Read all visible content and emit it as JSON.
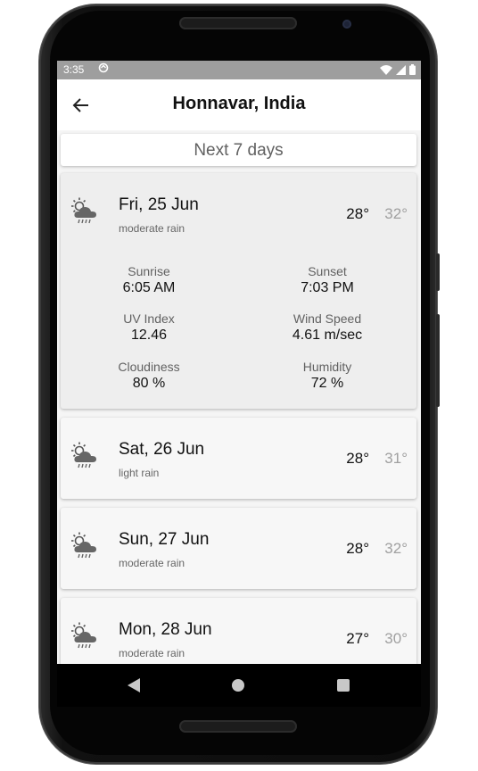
{
  "status_bar": {
    "time": "3:35"
  },
  "app_bar": {
    "title": "Honnavar, India"
  },
  "next_button": {
    "label": "Next 7 days"
  },
  "days": [
    {
      "date": "Fri, 25 Jun",
      "description": "moderate rain",
      "min": "28°",
      "max": "32°",
      "details": {
        "sunrise_label": "Sunrise",
        "sunrise": "6:05 AM",
        "sunset_label": "Sunset",
        "sunset": "7:03 PM",
        "uv_label": "UV Index",
        "uv": "12.46",
        "wind_label": "Wind Speed",
        "wind": "4.61 m/sec",
        "cloud_label": "Cloudiness",
        "cloud": "80 %",
        "humidity_label": "Humidity",
        "humidity": "72 %"
      }
    },
    {
      "date": "Sat, 26 Jun",
      "description": "light rain",
      "min": "28°",
      "max": "31°"
    },
    {
      "date": "Sun, 27 Jun",
      "description": "moderate rain",
      "min": "28°",
      "max": "32°"
    },
    {
      "date": "Mon, 28 Jun",
      "description": "moderate rain",
      "min": "27°",
      "max": "30°"
    }
  ],
  "icons": {
    "weather": "sun-cloud-rain-icon",
    "back": "arrow-left-icon"
  },
  "colors": {
    "status_bar": "#9e9e9e",
    "expanded_card": "#eeeeee",
    "max_temp": "#a0a0a0"
  }
}
